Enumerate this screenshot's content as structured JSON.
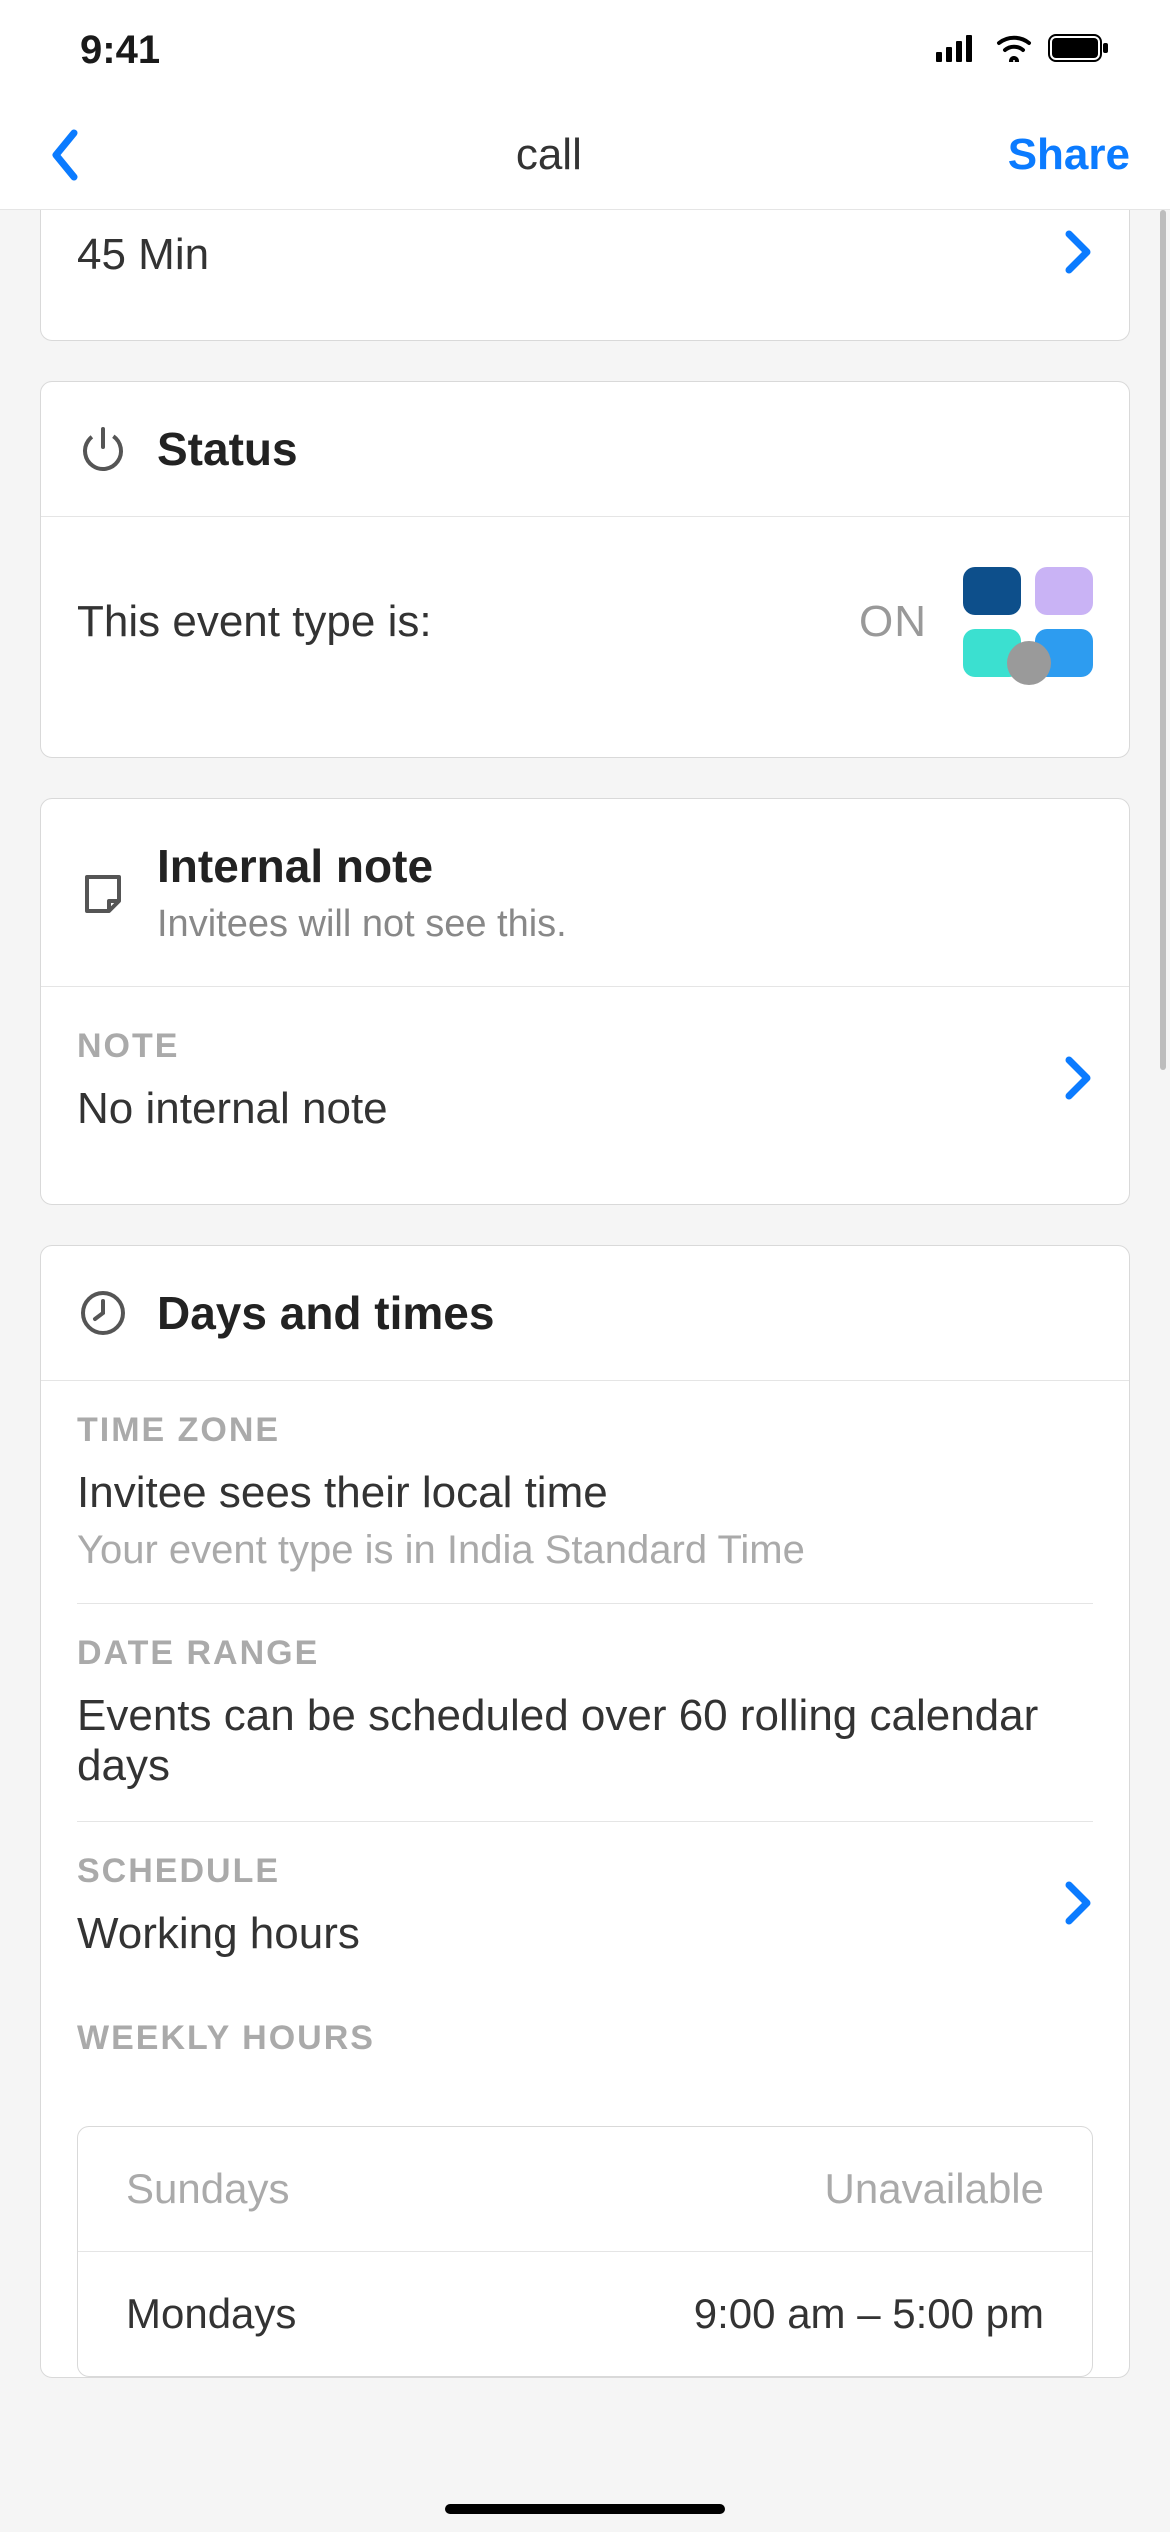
{
  "statusBar": {
    "time": "9:41"
  },
  "nav": {
    "title": "call",
    "share": "Share"
  },
  "duration": {
    "value": "45 Min"
  },
  "status": {
    "title": "Status",
    "label": "This event type is:",
    "state": "ON"
  },
  "internalNote": {
    "title": "Internal note",
    "subtitle": "Invitees will not see this.",
    "fieldLabel": "NOTE",
    "value": "No internal note"
  },
  "daysTimes": {
    "title": "Days and times",
    "timezone": {
      "label": "TIME ZONE",
      "value": "Invitee sees their local time",
      "sub": "Your event type is in India Standard Time"
    },
    "dateRange": {
      "label": "DATE RANGE",
      "value": "Events can be scheduled over 60 rolling calendar days"
    },
    "schedule": {
      "label": "SCHEDULE",
      "value": "Working hours"
    },
    "weekly": {
      "label": "WEEKLY HOURS",
      "rows": [
        {
          "day": "Sundays",
          "hours": "Unavailable",
          "available": false
        },
        {
          "day": "Mondays",
          "hours": "9:00 am – 5:00 pm",
          "available": true
        }
      ]
    }
  }
}
